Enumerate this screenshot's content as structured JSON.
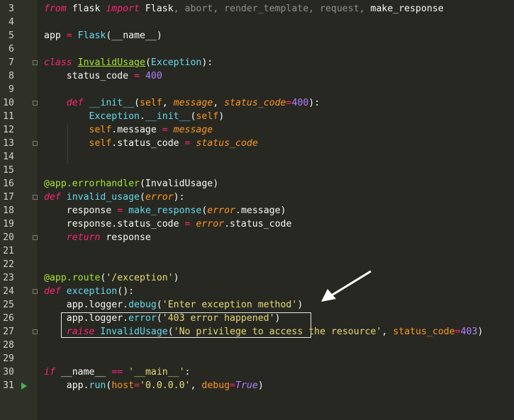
{
  "editor": {
    "line_numbers": [
      "3",
      "4",
      "5",
      "6",
      "7",
      "8",
      "9",
      "10",
      "11",
      "12",
      "13",
      "14",
      "15",
      "16",
      "17",
      "18",
      "19",
      "20",
      "21",
      "22",
      "23",
      "24",
      "25",
      "26",
      "27",
      "28",
      "29",
      "30",
      "31"
    ],
    "lines": {
      "l3": [
        [
          "k",
          "from"
        ],
        [
          "n",
          " flask "
        ],
        [
          "k",
          "import"
        ],
        [
          "n",
          " Flask"
        ],
        [
          "dim",
          ", abort, render_template, request, "
        ],
        [
          "n",
          "make_response"
        ]
      ],
      "l5": [
        [
          "n",
          "app "
        ],
        [
          "kp",
          "="
        ],
        [
          "n",
          " "
        ],
        [
          "f",
          "Flask"
        ],
        [
          "n",
          "(__name__)"
        ]
      ],
      "l7": [
        [
          "k",
          "class"
        ],
        [
          "n",
          " "
        ],
        [
          "cls",
          "InvalidUsage"
        ],
        [
          "n",
          "("
        ],
        [
          "b",
          "Exception"
        ],
        [
          "n",
          "):"
        ]
      ],
      "l8": [
        [
          "n",
          "    status_code "
        ],
        [
          "kp",
          "="
        ],
        [
          "n",
          " "
        ],
        [
          "num",
          "400"
        ]
      ],
      "l10": [
        [
          "n",
          "    "
        ],
        [
          "k",
          "def"
        ],
        [
          "n",
          " "
        ],
        [
          "f",
          "__init__"
        ],
        [
          "n",
          "("
        ],
        [
          "sf",
          "self"
        ],
        [
          "n",
          ", "
        ],
        [
          "p",
          "message"
        ],
        [
          "n",
          ", "
        ],
        [
          "p",
          "status_code"
        ],
        [
          "kp",
          "="
        ],
        [
          "num",
          "400"
        ],
        [
          "n",
          "):"
        ]
      ],
      "l11": [
        [
          "n",
          "        "
        ],
        [
          "b",
          "Exception"
        ],
        [
          "n",
          "."
        ],
        [
          "f",
          "__init__"
        ],
        [
          "n",
          "("
        ],
        [
          "sf",
          "self"
        ],
        [
          "n",
          ")"
        ]
      ],
      "l12": [
        [
          "n",
          "        "
        ],
        [
          "sf",
          "self"
        ],
        [
          "n",
          ".message "
        ],
        [
          "kp",
          "="
        ],
        [
          "n",
          " "
        ],
        [
          "p",
          "message"
        ]
      ],
      "l13": [
        [
          "n",
          "        "
        ],
        [
          "sf",
          "self"
        ],
        [
          "n",
          ".status_code "
        ],
        [
          "kp",
          "="
        ],
        [
          "n",
          " "
        ],
        [
          "p",
          "status_code"
        ]
      ],
      "l16": [
        [
          "dec",
          "@app.errorhandler"
        ],
        [
          "n",
          "(InvalidUsage)"
        ]
      ],
      "l17": [
        [
          "k",
          "def"
        ],
        [
          "n",
          " "
        ],
        [
          "f",
          "invalid_usage"
        ],
        [
          "n",
          "("
        ],
        [
          "p",
          "error"
        ],
        [
          "n",
          "):"
        ]
      ],
      "l18": [
        [
          "n",
          "    response "
        ],
        [
          "kp",
          "="
        ],
        [
          "n",
          " "
        ],
        [
          "f",
          "make_response"
        ],
        [
          "n",
          "("
        ],
        [
          "p",
          "error"
        ],
        [
          "n",
          ".message)"
        ]
      ],
      "l19": [
        [
          "n",
          "    response.status_code "
        ],
        [
          "kp",
          "="
        ],
        [
          "n",
          " "
        ],
        [
          "p",
          "error"
        ],
        [
          "n",
          ".status_code"
        ]
      ],
      "l20": [
        [
          "n",
          "    "
        ],
        [
          "k",
          "return"
        ],
        [
          "n",
          " response"
        ]
      ],
      "l23": [
        [
          "dec",
          "@app.route"
        ],
        [
          "n",
          "("
        ],
        [
          "s",
          "'/exception'"
        ],
        [
          "n",
          ")"
        ]
      ],
      "l24": [
        [
          "k",
          "def"
        ],
        [
          "n",
          " "
        ],
        [
          "f",
          "exception"
        ],
        [
          "n",
          "():"
        ]
      ],
      "l25": [
        [
          "n",
          "    app.logger."
        ],
        [
          "f",
          "debug"
        ],
        [
          "n",
          "("
        ],
        [
          "s",
          "'Enter exception method'"
        ],
        [
          "n",
          ")"
        ]
      ],
      "l26": [
        [
          "n",
          "    app.logger."
        ],
        [
          "f",
          "error"
        ],
        [
          "n",
          "("
        ],
        [
          "s",
          "'403 error happened'"
        ],
        [
          "n",
          ")"
        ]
      ],
      "l27": [
        [
          "n",
          "    "
        ],
        [
          "k",
          "raise"
        ],
        [
          "n",
          " "
        ],
        [
          "b",
          "InvalidUsage"
        ],
        [
          "n",
          "("
        ],
        [
          "s",
          "'No privilege to access the resource'"
        ],
        [
          "n",
          ", "
        ],
        [
          "sf",
          "status_code"
        ],
        [
          "kp",
          "="
        ],
        [
          "num",
          "403"
        ],
        [
          "n",
          ")"
        ]
      ],
      "l30": [
        [
          "k",
          "if"
        ],
        [
          "n",
          " __name__ "
        ],
        [
          "kp",
          "=="
        ],
        [
          "n",
          " "
        ],
        [
          "s",
          "'__main__'"
        ],
        [
          "n",
          ":"
        ]
      ],
      "l31": [
        [
          "n",
          "    app."
        ],
        [
          "f",
          "run"
        ],
        [
          "n",
          "("
        ],
        [
          "sf",
          "host"
        ],
        [
          "kp",
          "="
        ],
        [
          "s",
          "'0.0.0.0'"
        ],
        [
          "n",
          ", "
        ],
        [
          "sf",
          "debug"
        ],
        [
          "kp",
          "="
        ],
        [
          "tr",
          "True"
        ],
        [
          "n",
          ")"
        ]
      ]
    }
  },
  "colors": {
    "background": "#272822",
    "gutter": "#2f3129",
    "keyword": "#f92672",
    "string": "#e6db74",
    "function": "#66d9ef",
    "number": "#ae81ff",
    "parameter": "#fd971f",
    "decorator": "#a6e22e",
    "annotation": "#ffffff"
  },
  "icons": {
    "run": "run-arrow-icon",
    "annotation_arrow": "arrow-pointer-icon"
  }
}
